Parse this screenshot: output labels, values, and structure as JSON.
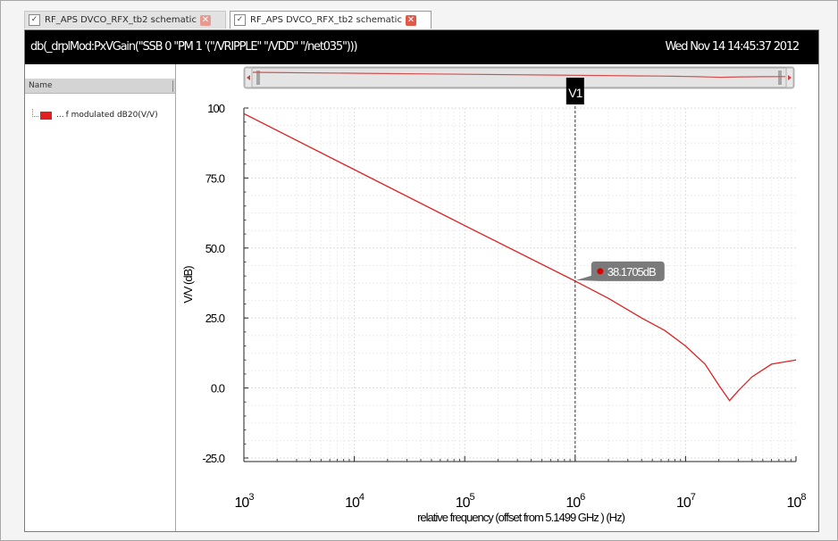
{
  "tabs": [
    {
      "label": "RF_APS DVCO_RFX_tb2 schematic",
      "active": false
    },
    {
      "label": "RF_APS DVCO_RFX_tb2 schematic",
      "active": true
    }
  ],
  "window": {
    "expression": "db(_drplMod:PxVGain(\"SSB 0 \"PM 1 '(\"/VRIPPLE\" \"/VDD\" \"/net035\")))",
    "timestamp": "Wed Nov 14 14:45:37 2012"
  },
  "sidebar": {
    "header": "Name",
    "legend": [
      {
        "label": "f modulated dB20(V/V)",
        "ellipsis": "..."
      }
    ]
  },
  "marker": {
    "name": "V1",
    "readout": "38.1705dB",
    "x": 1000000
  },
  "colors": {
    "trace": "#e02020",
    "marker_dot": "#d40000",
    "scroll_line": "#d45050"
  },
  "chart_data": {
    "type": "line",
    "xscale": "log",
    "xlim": [
      1000,
      100000000
    ],
    "ylim": [
      -25,
      100
    ],
    "xlabel": "relative frequency (offset from 5.1499 GHz ) (Hz)",
    "ylabel": "V/V (dB)",
    "xticks": [
      {
        "base": "10",
        "exp": "3",
        "value": 1000
      },
      {
        "base": "10",
        "exp": "4",
        "value": 10000
      },
      {
        "base": "10",
        "exp": "5",
        "value": 100000
      },
      {
        "base": "10",
        "exp": "6",
        "value": 1000000
      },
      {
        "base": "10",
        "exp": "7",
        "value": 10000000
      },
      {
        "base": "10",
        "exp": "8",
        "value": 100000000
      }
    ],
    "yticks": [
      {
        "label": "100",
        "value": 100
      },
      {
        "label": "75.0",
        "value": 75
      },
      {
        "label": "50.0",
        "value": 50
      },
      {
        "label": "25.0",
        "value": 25
      },
      {
        "label": "0.0",
        "value": 0
      },
      {
        "label": "-25.0",
        "value": -25
      }
    ],
    "grid": true,
    "series": [
      {
        "name": "f modulated dB20(V/V)",
        "x": [
          1000,
          10000,
          100000,
          1000000,
          2000000,
          4000000,
          6500000,
          10000000,
          15000000,
          20000000,
          25000000,
          30000000,
          40000000,
          60000000,
          100000000
        ],
        "y": [
          98,
          78,
          58,
          38.2,
          32,
          25,
          20.5,
          15,
          8.5,
          1,
          -4.5,
          -1,
          4,
          8.5,
          10
        ]
      }
    ]
  }
}
